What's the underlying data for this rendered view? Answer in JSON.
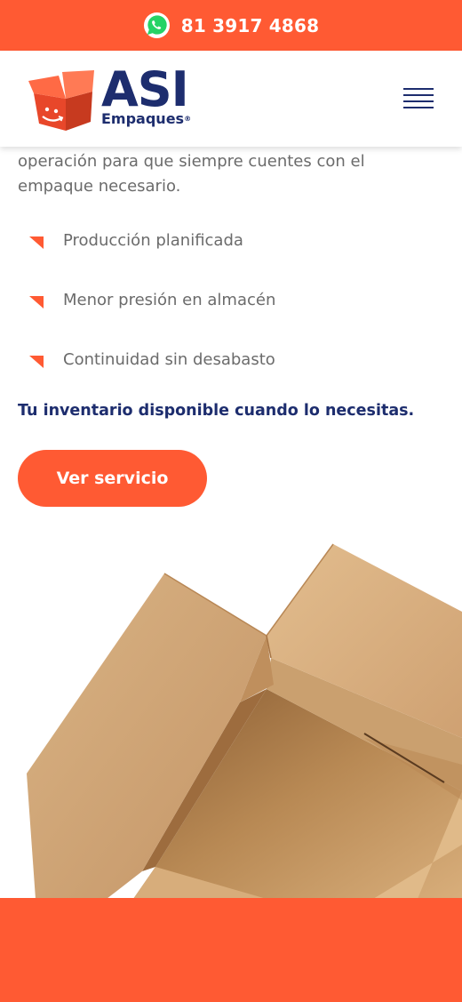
{
  "topbar": {
    "icon": "whatsapp-icon",
    "phone": "81 3917 4868",
    "background": "#ff5a33"
  },
  "header": {
    "logo": {
      "title": "ASI",
      "subtitle": "Empaques",
      "registered": "®",
      "icon": "box-mascot-icon"
    },
    "menu_icon": "hamburger-menu-icon"
  },
  "content": {
    "intro": "operación para que siempre cuentes con el empaque necesario.",
    "bullets": [
      {
        "icon": "orange-triangle-icon",
        "label": "Producción planificada"
      },
      {
        "icon": "orange-triangle-icon",
        "label": "Menor presión en almacén"
      },
      {
        "icon": "orange-triangle-icon",
        "label": "Continuidad sin desabasto"
      }
    ],
    "tagline": "Tu inventario disponible cuando lo necesitas.",
    "cta_label": "Ver servicio"
  },
  "colors": {
    "brand_orange": "#ff5a33",
    "brand_navy": "#1d2d6e",
    "body_text": "#6b6b6b"
  },
  "image": {
    "icon": "open-cardboard-box-image"
  }
}
